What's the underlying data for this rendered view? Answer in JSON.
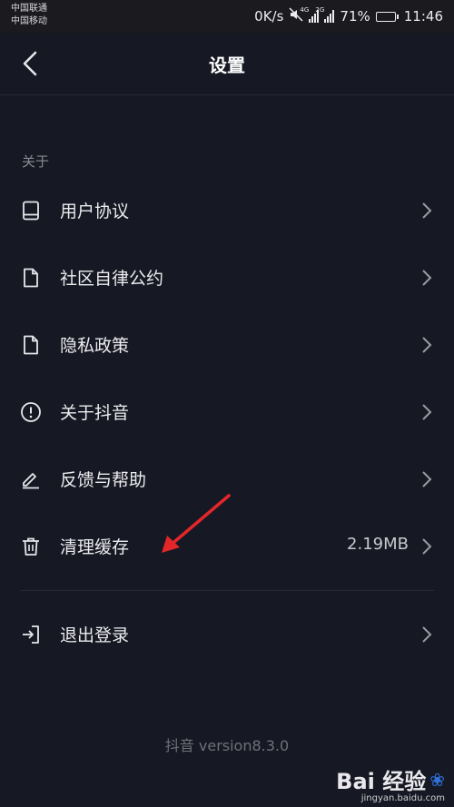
{
  "status_bar": {
    "carrier_1": "中国联通",
    "carrier_2": "中国移动",
    "net_speed": "0K/s",
    "sim1_tag": "4G",
    "sim2_tag": "2G",
    "battery_percent": "71%",
    "battery_level": 0.71,
    "time": "11:46"
  },
  "header": {
    "title": "设置"
  },
  "section": {
    "about_label": "关于"
  },
  "menu": {
    "items": [
      {
        "label": "用户协议",
        "icon": "book-icon"
      },
      {
        "label": "社区自律公约",
        "icon": "document-icon"
      },
      {
        "label": "隐私政策",
        "icon": "document-icon"
      },
      {
        "label": "关于抖音",
        "icon": "info-circle-icon"
      },
      {
        "label": "反馈与帮助",
        "icon": "edit-pen-icon"
      },
      {
        "label": "清理缓存",
        "icon": "trash-icon",
        "value": "2.19MB"
      },
      {
        "label": "退出登录",
        "icon": "logout-icon"
      }
    ]
  },
  "footer": {
    "version": "抖音 version8.3.0"
  },
  "watermark": {
    "brand": "Bai  经验",
    "url": "jingyan.baidu.com"
  },
  "colors": {
    "background": "#161823",
    "annotation_arrow": "#e3262a"
  }
}
